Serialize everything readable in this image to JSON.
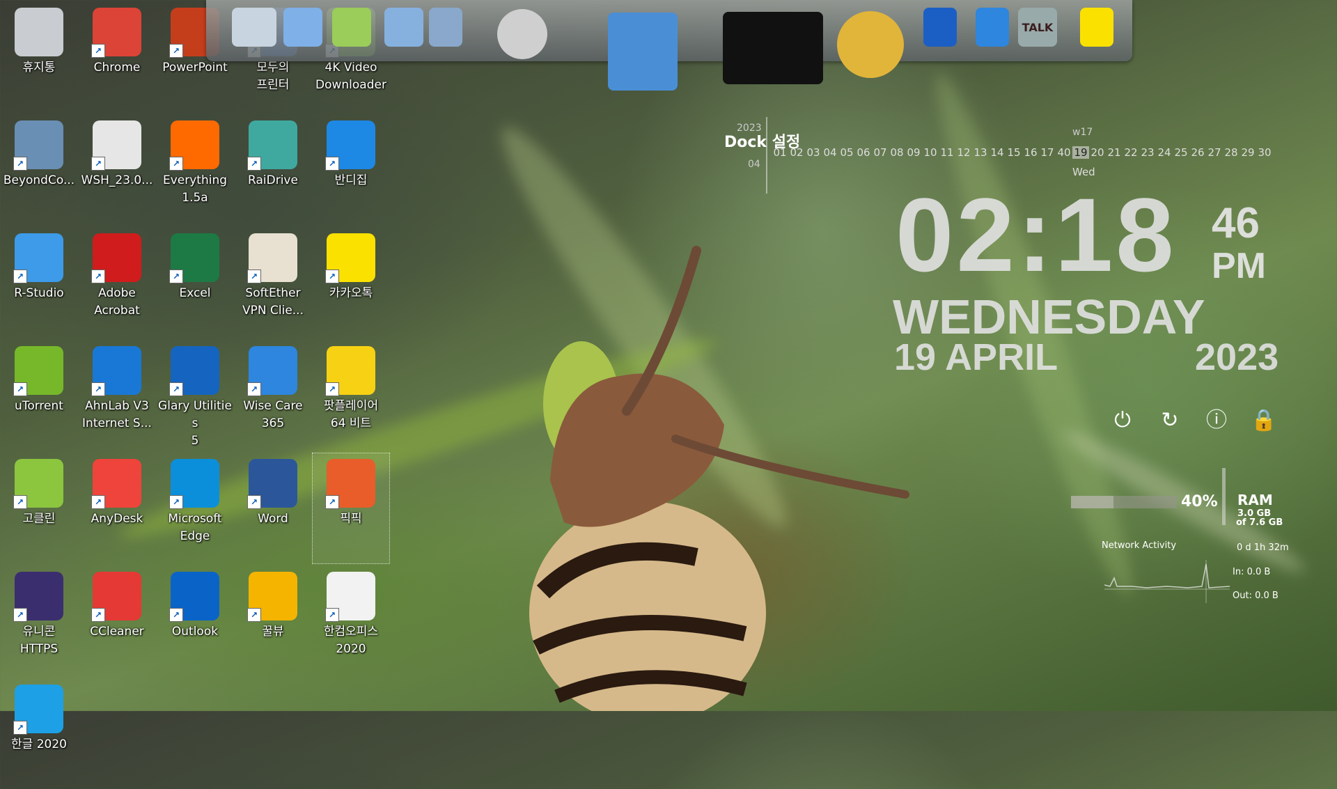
{
  "desktop_icons": [
    {
      "label": "휴지통",
      "icon": "recycle-bin-icon",
      "color": "#c9ccd0"
    },
    {
      "label": "Chrome",
      "icon": "chrome-icon",
      "color": "#db4437"
    },
    {
      "label": "PowerPoint",
      "icon": "powerpoint-icon",
      "color": "#c43e1c"
    },
    {
      "label": "모두의\n프린터",
      "icon": "printer-icon",
      "color": "#5a8fd6"
    },
    {
      "label": "4K Video\nDownloader",
      "icon": "download-icon",
      "color": "#8bc34a"
    },
    {
      "label": "BeyondCo...",
      "icon": "beyondcompare-icon",
      "color": "#6a8fb5"
    },
    {
      "label": "WSH_23.0...",
      "icon": "disc-icon",
      "color": "#e6e6e6"
    },
    {
      "label": "Everything\n1.5a",
      "icon": "search-icon",
      "color": "#ff6a00"
    },
    {
      "label": "RaiDrive",
      "icon": "raidrive-icon",
      "color": "#3fa9a0"
    },
    {
      "label": "반디집",
      "icon": "bandizip-icon",
      "color": "#1e88e5"
    },
    {
      "label": "R-Studio",
      "icon": "rstudio-icon",
      "color": "#3d9be9"
    },
    {
      "label": "Adobe\nAcrobat",
      "icon": "acrobat-icon",
      "color": "#d01c1c"
    },
    {
      "label": "Excel",
      "icon": "excel-icon",
      "color": "#1d7a45"
    },
    {
      "label": "SoftEther\nVPN Clie...",
      "icon": "vpn-icon",
      "color": "#e8e0d0"
    },
    {
      "label": "카카오톡",
      "icon": "kakaotalk-icon",
      "color": "#fae100"
    },
    {
      "label": "uTorrent",
      "icon": "utorrent-icon",
      "color": "#76b82a"
    },
    {
      "label": "AhnLab V3\nInternet S...",
      "icon": "ahnlab-icon",
      "color": "#1978d6"
    },
    {
      "label": "Glary Utilities\n5",
      "icon": "glary-icon",
      "color": "#1565c0"
    },
    {
      "label": "Wise Care\n365",
      "icon": "wisecare-icon",
      "color": "#2e86de"
    },
    {
      "label": "팟플레이어\n64 비트",
      "icon": "potplayer-icon",
      "color": "#f7d114"
    },
    {
      "label": "고클린",
      "icon": "goclean-icon",
      "color": "#8cc63f"
    },
    {
      "label": "AnyDesk",
      "icon": "anydesk-icon",
      "color": "#ef443b"
    },
    {
      "label": "Microsoft\nEdge",
      "icon": "edge-icon",
      "color": "#0c8fdb"
    },
    {
      "label": "Word",
      "icon": "word-icon",
      "color": "#2b579a"
    },
    {
      "label": "픽픽",
      "icon": "picpick-icon",
      "color": "#e85d2a"
    },
    {
      "label": "유니콘\nHTTPS",
      "icon": "unicorn-icon",
      "color": "#3b2e6e"
    },
    {
      "label": "CCleaner",
      "icon": "ccleaner-icon",
      "color": "#e53935"
    },
    {
      "label": "Outlook",
      "icon": "outlook-icon",
      "color": "#0a64c8"
    },
    {
      "label": "꿀뷰",
      "icon": "honeyview-icon",
      "color": "#f4b400"
    },
    {
      "label": "한컴오피스\n2020",
      "icon": "hancom-icon",
      "color": "#f2f2f2"
    },
    {
      "label": "한글 2020",
      "icon": "hangul-icon",
      "color": "#1ea0e6"
    }
  ],
  "dock": {
    "items": [
      "network-printer-icon",
      "folder-icon",
      "folder-icon",
      "folder-icon",
      "tools-icon",
      "globe-icon",
      "tshirt-icon",
      "hammer-icon",
      "glary-icon",
      "wisecare-icon",
      "recycle-r-icon",
      "kakaotalk-icon",
      "trash-icon"
    ],
    "kakao_text": "TALK",
    "settings_label": "Dock 설정"
  },
  "calendar": {
    "year": "2023",
    "month": "04",
    "week": "w17",
    "days": [
      "01",
      "02",
      "03",
      "04",
      "05",
      "06",
      "07",
      "08",
      "09",
      "10",
      "11",
      "12",
      "13",
      "14",
      "15",
      "16",
      "17",
      "40",
      "19",
      "20",
      "21",
      "22",
      "23",
      "24",
      "25",
      "26",
      "27",
      "28",
      "29",
      "30"
    ],
    "today": "19",
    "today_dow": "Wed"
  },
  "clock": {
    "time": "02:18",
    "seconds": "46",
    "ampm": "PM",
    "weekday": "WEDNESDAY",
    "date": "19 APRIL",
    "year": "2023"
  },
  "controls": [
    "power-icon",
    "restart-icon",
    "shutdown-icon",
    "lock-icon"
  ],
  "ram": {
    "percent": "40%",
    "label": "RAM",
    "used": "3.0 GB",
    "total": "of 7.6 GB",
    "fill_fraction": 0.4
  },
  "network": {
    "title": "Network Activity",
    "uptime": "0 d 1h 32m",
    "in": "In: 0.0 B",
    "out": "Out: 0.0 B"
  }
}
